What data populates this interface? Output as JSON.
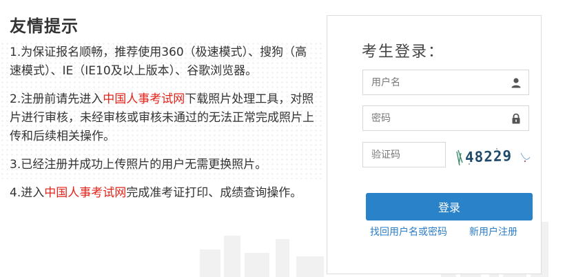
{
  "notice": {
    "title": "友情提示",
    "item1": "1.为保证报名顺畅，推荐使用360（极速模式）、搜狗（高速模式）、IE（IE10及以上版本）、谷歌浏览器。",
    "item2_pre": "2.注册前请先进入",
    "item2_link": "中国人事考试网",
    "item2_post": "下载照片处理工具，对照片进行审核，未经审核或审核未通过的无法正常完成照片上传和后续相关操作。",
    "item3": "3.已经注册并成功上传照片的用户无需更换照片。",
    "item4_pre": "4.进入",
    "item4_link": "中国人事考试网",
    "item4_post": "完成准考证打印、成绩查询操作。"
  },
  "login": {
    "title": "考生登录：",
    "username_placeholder": "用户名",
    "password_placeholder": "密码",
    "captcha_placeholder": "验证码",
    "captcha_text": "48229",
    "submit_label": "登录",
    "forgot_link": "找回用户名或密码",
    "register_link": "新用户注册"
  },
  "colors": {
    "accent": "#2a82c9",
    "link": "#2a7cc7",
    "highlight": "#e2231a"
  },
  "icons": {
    "username": "user-icon",
    "password": "lock-icon"
  }
}
